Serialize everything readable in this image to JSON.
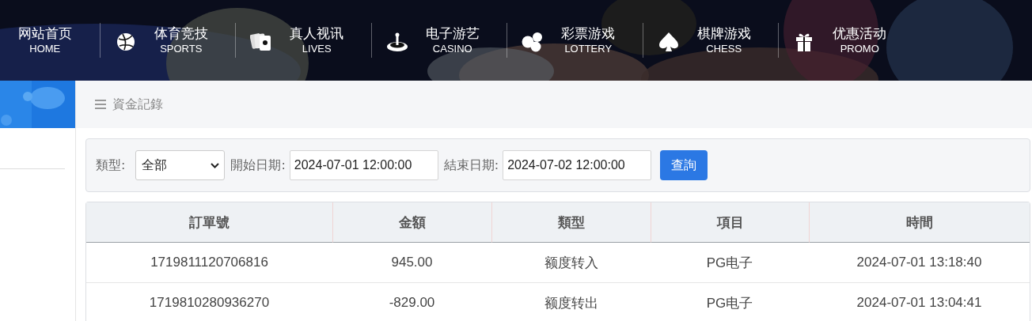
{
  "nav": [
    {
      "title": "网站首页",
      "subtitle": "HOME"
    },
    {
      "title": "体育竞技",
      "subtitle": "SPORTS"
    },
    {
      "title": "真人视讯",
      "subtitle": "LIVES"
    },
    {
      "title": "电子游艺",
      "subtitle": "CASINO"
    },
    {
      "title": "彩票游戏",
      "subtitle": "LOTTERY"
    },
    {
      "title": "棋牌游戏",
      "subtitle": "CHESS"
    },
    {
      "title": "优惠活动",
      "subtitle": "PROMO"
    }
  ],
  "breadcrumb": "資金記錄",
  "filter": {
    "type_label": "類型:",
    "type_value": "全部",
    "start_label": "開始日期:",
    "start_value": "2024-07-01 12:00:00",
    "end_label": "結束日期:",
    "end_value": "2024-07-02 12:00:00",
    "search_button": "查詢"
  },
  "table": {
    "columns": [
      "訂單號",
      "金額",
      "類型",
      "項目",
      "時間"
    ],
    "rows": [
      [
        "1719811120706816",
        "945.00",
        "额度转入",
        "PG电子",
        "2024-07-01 13:18:40"
      ],
      [
        "1719810280936270",
        "-829.00",
        "额度转出",
        "PG电子",
        "2024-07-01 13:04:41"
      ]
    ]
  }
}
